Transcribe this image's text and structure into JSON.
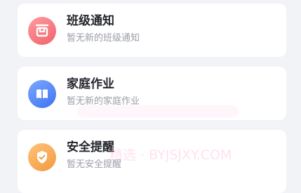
{
  "cards": [
    {
      "title": "班级通知",
      "subtitle": "暂无新的班级通知",
      "icon": "class-notice-icon",
      "color": "#f0636b"
    },
    {
      "title": "家庭作业",
      "subtitle": "暂无新的家庭作业",
      "icon": "book-icon",
      "color": "#3f73f0"
    },
    {
      "title": "安全提醒",
      "subtitle": "暂无安全提醒",
      "icon": "shield-check-icon",
      "color": "#f39a3e"
    }
  ],
  "watermark": "精选 · BYJSJXY.COM"
}
